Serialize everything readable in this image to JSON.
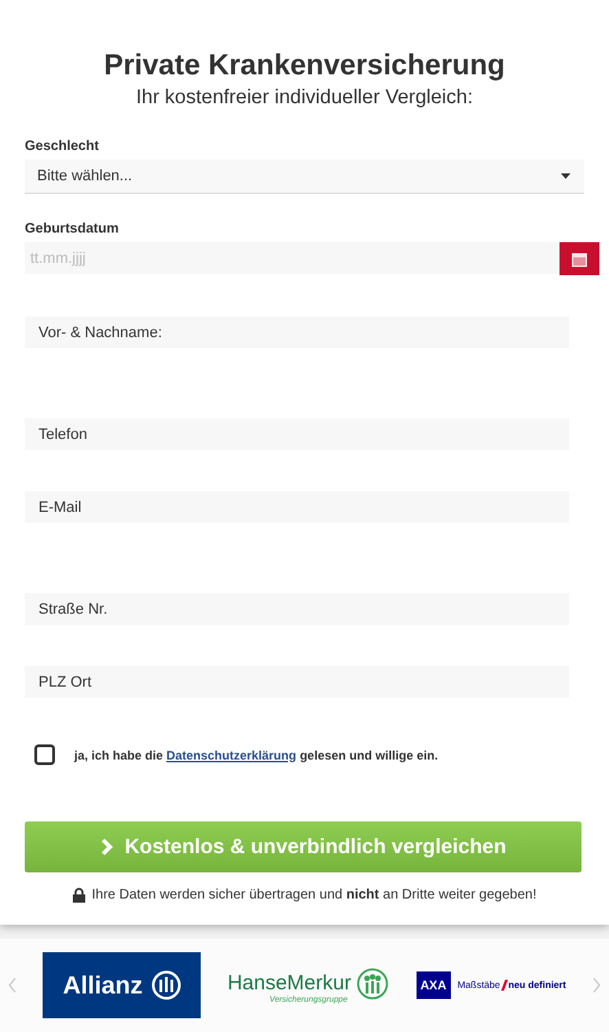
{
  "title": "Private Krankenversicherung",
  "subtitle": "Ihr kostenfreier individueller Vergleich:",
  "gender": {
    "label": "Geschlecht",
    "value": "Bitte wählen..."
  },
  "birthdate": {
    "label": "Geburtsdatum",
    "placeholder": "tt.mm.jjjj"
  },
  "field_groups": [
    [
      {
        "placeholder": "Vor- & Nachname:"
      }
    ],
    [
      {
        "placeholder": "Telefon"
      },
      {
        "placeholder": "E-Mail"
      }
    ],
    [
      {
        "placeholder": "Straße Nr."
      },
      {
        "placeholder": "PLZ Ort"
      }
    ]
  ],
  "consent": {
    "checked": false,
    "before": "ja, ich habe die",
    "link": "Datenschutzerklärung",
    "after": "gelesen und willige ein."
  },
  "submit": "Kostenlos & unverbindlich vergleichen",
  "privacy_note": "Ihre Daten werden sicher übertragen und **nicht** an Dritte weiter gegeben!",
  "logos": [
    {
      "kind": "allianz",
      "name": "Allianz"
    },
    {
      "kind": "hansemerkur",
      "name": "HanseMerkur",
      "tagline": "Versicherungsgruppe"
    },
    {
      "kind": "axa",
      "name": "AXA",
      "slogan": "Maßstäbe",
      "slogan_bold": "neu definiert"
    }
  ]
}
